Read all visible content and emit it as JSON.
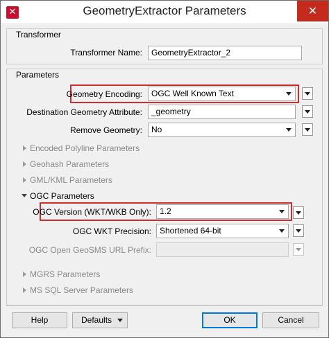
{
  "window": {
    "title": "GeometryExtractor Parameters",
    "close_glyph": "✕",
    "app_icon": "fme-icon",
    "app_icon_glyph": "✕"
  },
  "transformer": {
    "group_title": "Transformer",
    "name_label": "Transformer Name:",
    "name_value": "GeometryExtractor_2"
  },
  "parameters": {
    "group_title": "Parameters",
    "geometry_encoding": {
      "label": "Geometry Encoding:",
      "value": "OGC Well Known Text"
    },
    "destination_attribute": {
      "label": "Destination Geometry Attribute:",
      "value": "_geometry"
    },
    "remove_geometry": {
      "label": "Remove Geometry:",
      "value": "No"
    },
    "sections_collapsed_top": [
      "Encoded Polyline Parameters",
      "Geohash Parameters",
      "GML/KML Parameters"
    ],
    "ogc_section": {
      "title": "OGC Parameters",
      "version": {
        "label": "OGC Version (WKT/WKB Only):",
        "value": "1.2"
      },
      "precision": {
        "label": "OGC WKT Precision:",
        "value": "Shortened 64-bit"
      },
      "geosms_prefix": {
        "label": "OGC Open GeoSMS URL Prefix:",
        "value": ""
      }
    },
    "sections_collapsed_bottom": [
      "MGRS Parameters",
      "MS SQL Server Parameters"
    ]
  },
  "buttons": {
    "help": "Help",
    "defaults": "Defaults",
    "ok": "OK",
    "cancel": "Cancel"
  },
  "colors": {
    "highlight": "#d12b2b",
    "close_button": "#c42b1c",
    "focus_border": "#0078d7"
  }
}
